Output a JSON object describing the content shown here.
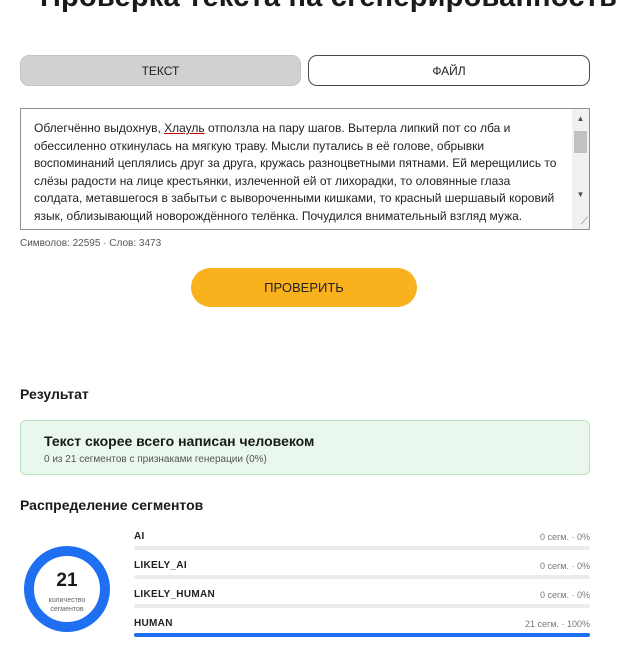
{
  "page": {
    "title": "Проверка текста на сгенерированность"
  },
  "tabs": [
    {
      "label": "ТЕКСТ",
      "active": true
    },
    {
      "label": "ФАЙЛ",
      "active": false
    }
  ],
  "input": {
    "text_before_underline": "Облегчённо выдохнув, ",
    "underlined_word": "Хлауль",
    "text_after_underline": " отползла на пару шагов. Вытерла липкий пот со лба и обессиленно откинулась на мягкую траву. Мысли путались в её голове, обрывки воспоминаний цеплялись друг за друга, кружась разноцветными пятнами. Ей мерещились то слёзы радости на лице крестьянки, излеченной ей от лихорадки, то оловянные глаза солдата, метавшегося в забытьи с вывороченными кишками, то красный шершавый коровий язык, облизывающий новорождённого телёнка. Почудился внимательный взгляд мужа. Хлауль почти ощутила ласковое прикосновение его сильных",
    "counts": "Символов: 22595 · Слов: 3473"
  },
  "check_button": {
    "label": "ПРОВЕРИТЬ"
  },
  "result": {
    "heading": "Результат",
    "title": "Текст скорее всего написан человеком",
    "subtitle": "0 из 21 сегментов с признаками генерации (0%)",
    "accent": "#eaf7ec"
  },
  "distribution": {
    "heading": "Распределение сегментов",
    "total": "21",
    "total_caption": "количество сегментов",
    "accent": "#1e6ff1",
    "rows": [
      {
        "label": "AI",
        "value": "0 сегм. · 0%",
        "fraction": 0
      },
      {
        "label": "LIKELY_AI",
        "value": "0 сегм. · 0%",
        "fraction": 0
      },
      {
        "label": "LIKELY_HUMAN",
        "value": "0 сегм. · 0%",
        "fraction": 0
      },
      {
        "label": "HUMAN",
        "value": "21 сегм. · 100%",
        "fraction": 1
      }
    ]
  },
  "icons": {
    "scroll_up": "scroll-up-arrow-icon",
    "scroll_down": "scroll-down-arrow-icon",
    "resize": "resize-grip-icon"
  }
}
